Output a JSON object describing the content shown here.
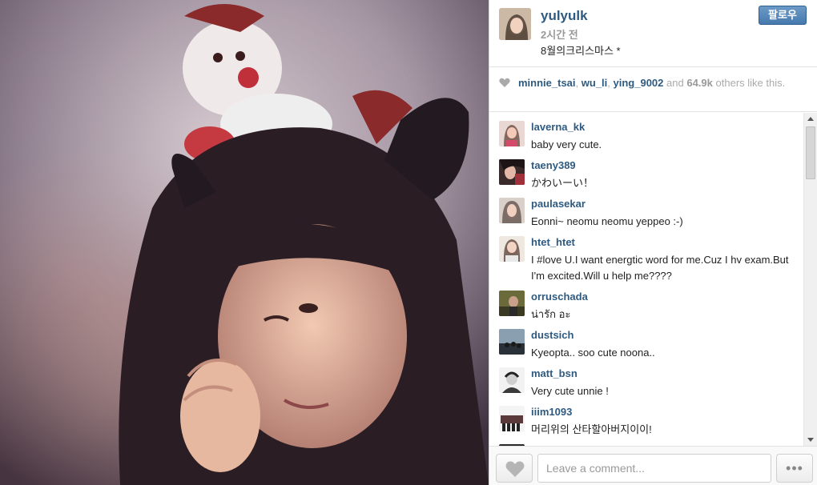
{
  "post": {
    "username": "yulyulk",
    "time": "2시간 전",
    "caption": "8월의크리스마스 *",
    "follow_label": "팔로우"
  },
  "likes": {
    "likers": [
      "minnie_tsai",
      "wu_li",
      "ying_9002"
    ],
    "and_text": "and",
    "count": "64.9k",
    "suffix": "others like this."
  },
  "comments": [
    {
      "user": "laverna_kk",
      "text": "baby very cute."
    },
    {
      "user": "taeny389",
      "text": "かわいーい！"
    },
    {
      "user": "paulasekar",
      "text": "Eonni~ neomu neomu yeppeo :-)"
    },
    {
      "user": "htet_htet",
      "text": "I #love U.I want energtic word for me.Cuz I hv exam.But I'm excited.Will u help me????"
    },
    {
      "user": "orruschada",
      "text": "น่ารัก อะ"
    },
    {
      "user": "dustsich",
      "text": "Kyeopta.. soo cute noona.."
    },
    {
      "user": "matt_bsn",
      "text": "Very cute unnie !"
    },
    {
      "user": "iiim1093",
      "text": "머리위의 산타할아버지이이!"
    }
  ],
  "footer": {
    "comment_placeholder": "Leave a comment...",
    "more_label": "•••"
  },
  "colors": {
    "username_blue": "#2f5a80",
    "follow_button": "#4679ad"
  }
}
